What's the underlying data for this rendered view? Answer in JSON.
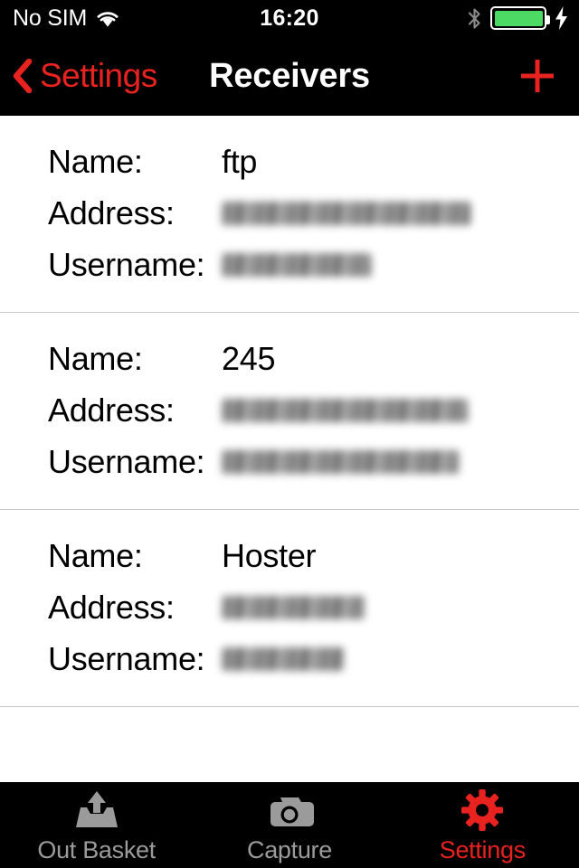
{
  "status_bar": {
    "carrier": "No SIM",
    "wifi_icon": "wifi-icon",
    "time": "16:20",
    "bluetooth_icon": "bluetooth-icon",
    "battery_icon": "battery-icon",
    "battery_color": "#4cd964",
    "charging_icon": "lightning-bolt-icon"
  },
  "nav_bar": {
    "back_icon": "chevron-left-icon",
    "back_label": "Settings",
    "title": "Receivers",
    "add_icon": "plus-icon",
    "accent_color": "#e8231f"
  },
  "labels": {
    "name": "Name:",
    "address": "Address:",
    "username": "Username:"
  },
  "receivers": [
    {
      "name": "ftp",
      "address": "[redacted]",
      "username": "[redacted]"
    },
    {
      "name": "245",
      "address": "[redacted]",
      "username": "[redacted]"
    },
    {
      "name": "Hoster",
      "address": "[redacted]",
      "username": "[redacted]"
    }
  ],
  "tab_bar": {
    "tabs": [
      {
        "label": "Out Basket",
        "icon": "outbox-upload-icon",
        "active": false
      },
      {
        "label": "Capture",
        "icon": "camera-icon",
        "active": false
      },
      {
        "label": "Settings",
        "icon": "gear-icon",
        "active": true
      }
    ],
    "active_color": "#e8231f",
    "inactive_color": "#9b9b9b"
  }
}
